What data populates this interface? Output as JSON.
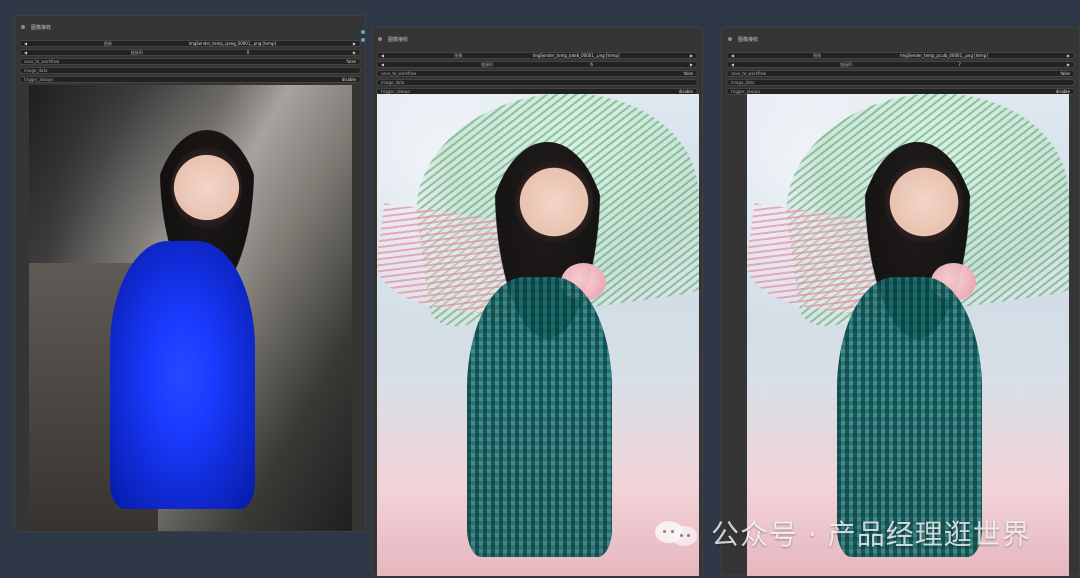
{
  "nodes": [
    {
      "title": "图像接收",
      "widgets": [
        {
          "label": "图像",
          "value": "ImgSender_temp_cjeeg_00001_.png [temp]"
        },
        {
          "label": "链接ID",
          "value": "0"
        },
        {
          "label": "save_to_workflow",
          "value": "false"
        },
        {
          "label": "image_data",
          "value": ""
        },
        {
          "label": "trigger_always",
          "value": "disable"
        }
      ]
    },
    {
      "title": "图像接收",
      "widgets": [
        {
          "label": "图像",
          "value": "ImgSender_temp_bdeb_00001_.png [temp]"
        },
        {
          "label": "链接ID",
          "value": "6"
        },
        {
          "label": "save_to_workflow",
          "value": "false"
        },
        {
          "label": "image_data",
          "value": ""
        },
        {
          "label": "trigger_always",
          "value": "disable"
        }
      ]
    },
    {
      "title": "图像接收",
      "widgets": [
        {
          "label": "图像",
          "value": "ImgSender_temp_pculb_00001_.png [temp]"
        },
        {
          "label": "链接ID",
          "value": "7"
        },
        {
          "label": "save_to_workflow",
          "value": "false"
        },
        {
          "label": "image_data",
          "value": ""
        },
        {
          "label": "trigger_always",
          "value": "disable"
        }
      ]
    }
  ],
  "watermark": {
    "text": "公众号 · 产品经理逛世界"
  },
  "colors": {
    "canvas_bg": "#2e3847",
    "node_bg": "#353535",
    "widget_bg": "#222222",
    "connector": "#55a8d6"
  }
}
